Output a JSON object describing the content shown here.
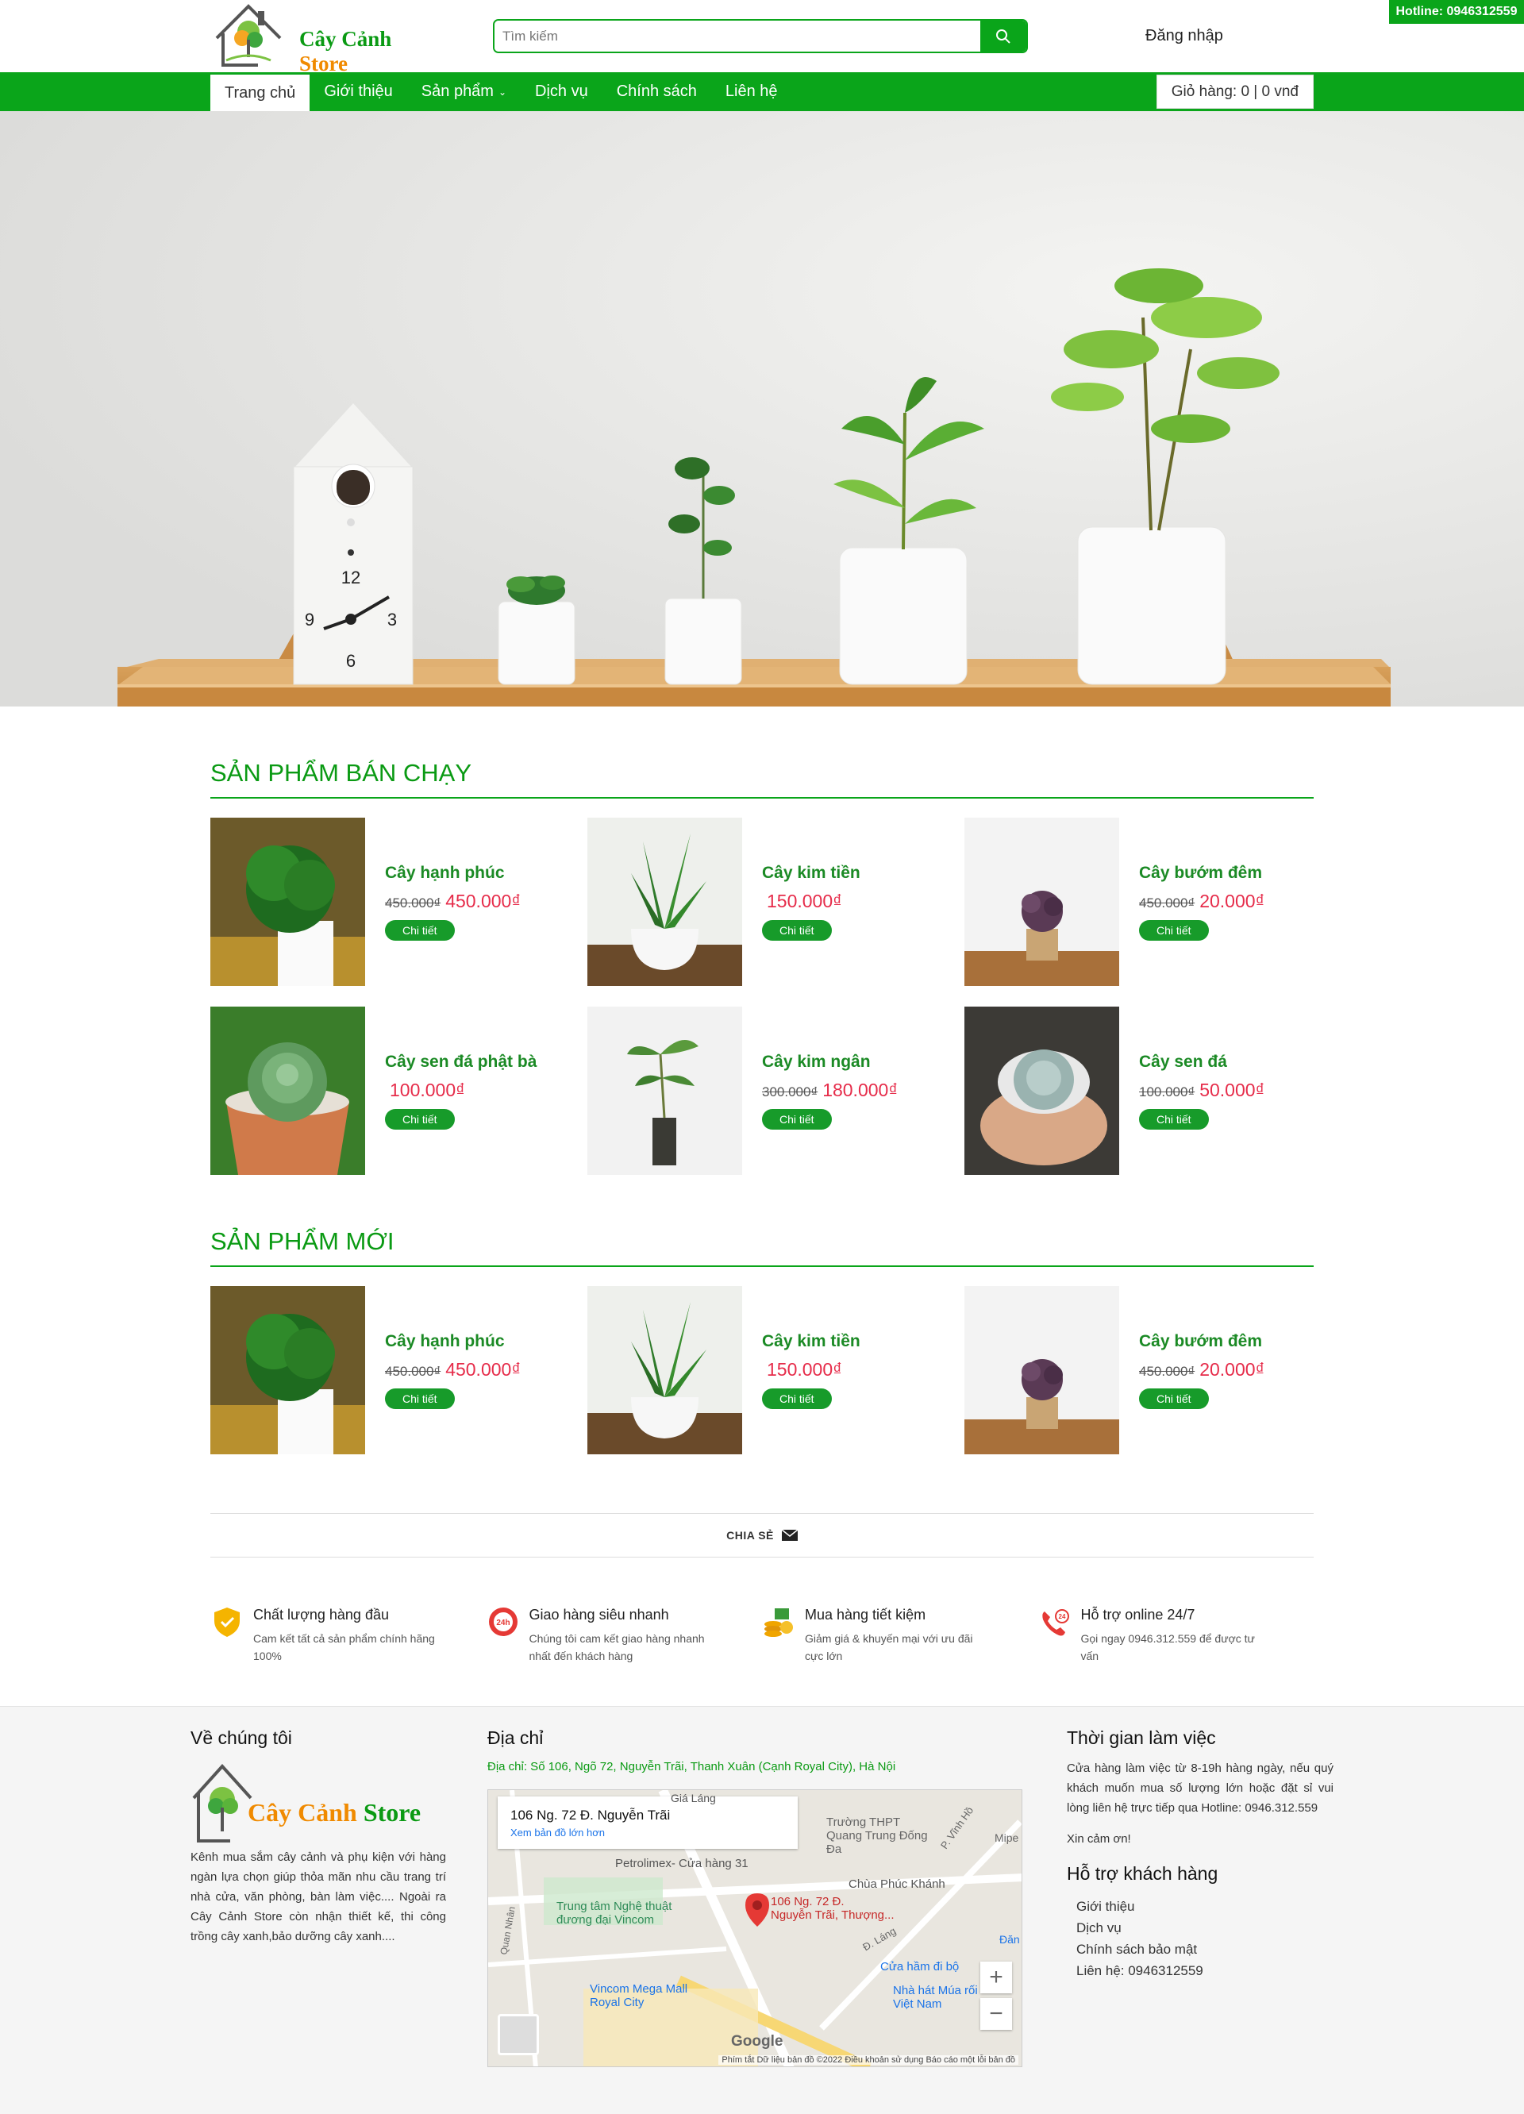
{
  "header": {
    "brand_main": "Cây Cảnh",
    "brand_store": "Store",
    "search_placeholder": "Tìm kiếm",
    "login_label": "Đăng nhập",
    "hotline": "Hotline: 0946312559"
  },
  "nav": {
    "items": [
      "Trang chủ",
      "Giới thiệu",
      "Sản phẩm",
      "Dịch vụ",
      "Chính sách",
      "Liên hệ"
    ],
    "cart_label": "Giỏ hàng: 0 | 0 vnđ"
  },
  "hero": {
    "clock_numbers": [
      "12",
      "3",
      "6",
      "9"
    ]
  },
  "bestsellers": {
    "title": "SẢN PHẨM BÁN CHẠY",
    "products": [
      {
        "name": "Cây hạnh phúc",
        "old_price": "450.000₫",
        "price": "450.000₫",
        "button": "Chi tiết"
      },
      {
        "name": "Cây kim tiền",
        "old_price": "",
        "price": "150.000₫",
        "button": "Chi tiết"
      },
      {
        "name": "Cây bướm đêm",
        "old_price": "450.000₫",
        "price": "20.000₫",
        "button": "Chi tiết"
      },
      {
        "name": "Cây sen đá phật bà",
        "old_price": "",
        "price": "100.000₫",
        "button": "Chi tiết"
      },
      {
        "name": "Cây kim ngân",
        "old_price": "300.000₫",
        "price": "180.000₫",
        "button": "Chi tiết"
      },
      {
        "name": "Cây sen đá",
        "old_price": "100.000₫",
        "price": "50.000₫",
        "button": "Chi tiết"
      }
    ]
  },
  "newproducts": {
    "title": "SẢN PHẨM MỚI",
    "products": [
      {
        "name": "Cây hạnh phúc",
        "old_price": "450.000₫",
        "price": "450.000₫",
        "button": "Chi tiết"
      },
      {
        "name": "Cây kim tiền",
        "old_price": "",
        "price": "150.000₫",
        "button": "Chi tiết"
      },
      {
        "name": "Cây bướm đêm",
        "old_price": "450.000₫",
        "price": "20.000₫",
        "button": "Chi tiết"
      }
    ]
  },
  "share_label": "CHIA SẺ",
  "features": [
    {
      "title": "Chất lượng hàng đầu",
      "desc": "Cam kết tất cả sản phẩm chính hãng 100%",
      "icon": "shield-icon",
      "color": "#f5b400"
    },
    {
      "title": "Giao hàng siêu nhanh",
      "desc": "Chúng tôi cam kết giao hàng nhanh nhất đến khách hàng",
      "icon": "delivery-24h-icon",
      "color": "#e53935"
    },
    {
      "title": "Mua hàng tiết kiệm",
      "desc": "Giảm giá & khuyến mại với ưu đãi cực lớn",
      "icon": "money-icon",
      "color": "#f0a500"
    },
    {
      "title": "Hỗ trợ online 24/7",
      "desc": "Gọi ngay 0946.312.559 để được tư vấn",
      "icon": "phone-24-icon",
      "color": "#e53935"
    }
  ],
  "footer": {
    "about_title": "Về chúng tôi",
    "about_text": "Kênh mua sắm cây cảnh và phụ kiện với hàng ngàn lựa chọn giúp thỏa mãn nhu cầu trang trí nhà cửa, văn phòng, bàn làm việc.... Ngoài ra Cây Cảnh Store còn nhận thiết kế, thi công trồng cây xanh,bảo dưỡng cây xanh....",
    "address_title": "Địa chỉ",
    "address_line": "Địa chỉ: Số 106, Ngõ 72, Nguyễn Trãi, Thanh Xuân (Cạnh Royal City), Hà Nội",
    "map": {
      "place": "106 Ng. 72 Đ. Nguyễn Trãi",
      "bigger_link": "Xem bản đồ lớn hơn",
      "pin_label_1": "106 Ng. 72 Đ.",
      "pin_label_2": "Nguyễn Trãi, Thượng...",
      "labels": [
        "Giá Láng",
        "Trường THPT Quang Trung Đống Đa",
        "Petrolimex- Cửa hàng 31",
        "Chùa Phúc Khánh",
        "Trung tâm Nghệ thuật đương đại Vincom",
        "Vincom Mega Mall Royal City",
        "Cửa hầm đi bộ",
        "Nhà hát Múa rối Việt Nam",
        "P. Vĩnh Hồ",
        "Mipe",
        "Đ. Láng",
        "Đăn",
        "Quan Nhân"
      ],
      "attribution": "Phím tắt   Dữ liệu bản đồ ©2022   Điều khoản sử dụng   Báo cáo một lỗi bản đồ",
      "google": "Google",
      "zoom_in": "+",
      "zoom_out": "−"
    },
    "hours_title": "Thời gian làm việc",
    "hours_text": "Cửa hàng làm việc từ 8-19h hàng ngày, nếu quý khách muốn mua số lượng lớn hoặc đặt sỉ vui lòng liên hệ trực tiếp qua Hotline: 0946.312.559",
    "thanks": "Xin cảm ơn!",
    "support_title": "Hỗ trợ khách hàng",
    "support_links": [
      "Giới thiệu",
      "Dịch vụ",
      "Chính sách bảo mật",
      "Liên hệ: 0946312559"
    ]
  }
}
